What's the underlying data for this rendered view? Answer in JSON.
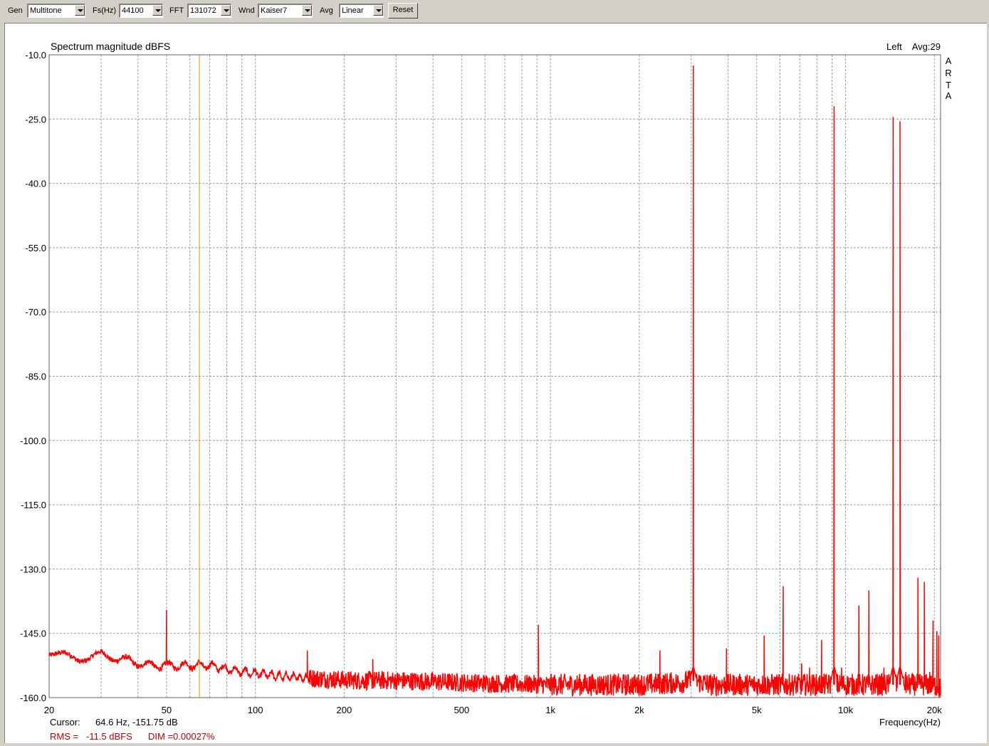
{
  "toolbar": {
    "gen_label": "Gen",
    "gen_value": "Multitone",
    "fs_label": "Fs(Hz)",
    "fs_value": "44100",
    "fft_label": "FFT",
    "fft_value": "131072",
    "wnd_label": "Wnd",
    "wnd_value": "Kaiser7",
    "avg_label": "Avg",
    "avg_value": "Linear",
    "reset_label": "Reset"
  },
  "plot": {
    "channel": "Left",
    "avg": "Avg:29",
    "brand_letters": [
      "A",
      "R",
      "T",
      "A"
    ],
    "cursor_label": "Cursor:",
    "cursor_value": "64.6 Hz, -151.75 dB",
    "rms_label": "RMS =",
    "rms_value": "-11.5 dBFS",
    "dim_label": "DIM =0.00027%"
  },
  "colors": {
    "trace": "#ff0000",
    "cursor_line": "#c8a000",
    "grid": "#a0a0a0",
    "rms_text": "#c00000"
  },
  "chart_data": {
    "type": "line",
    "title": "Spectrum magnitude dBFS",
    "xlabel": "Frequency(Hz)",
    "ylabel": "",
    "x_scale": "log",
    "xlim": [
      20,
      21000
    ],
    "ylim": [
      -160,
      -10
    ],
    "x_ticks": [
      20,
      50,
      100,
      200,
      500,
      1000,
      2000,
      5000,
      10000,
      20000
    ],
    "x_tick_labels": [
      "20",
      "50",
      "100",
      "200",
      "500",
      "1k",
      "2k",
      "5k",
      "10k",
      "20k"
    ],
    "y_ticks": [
      -10,
      -25,
      -40,
      -55,
      -70,
      -85,
      -100,
      -115,
      -130,
      -145,
      -160
    ],
    "y_tick_labels": [
      "-10.0",
      "-25.0",
      "-40.0",
      "-55.0",
      "-70.0",
      "-85.0",
      "-100.0",
      "-115.0",
      "-130.0",
      "-145.0",
      "-160.0"
    ],
    "grid": true,
    "cursor_x": 64.6,
    "noise_floor": [
      [
        20,
        -149.5
      ],
      [
        25,
        -151
      ],
      [
        30,
        -150
      ],
      [
        35,
        -151
      ],
      [
        40,
        -152
      ],
      [
        45,
        -152.5
      ],
      [
        55,
        -152.5
      ],
      [
        70,
        -152.5
      ],
      [
        90,
        -154
      ],
      [
        120,
        -155
      ],
      [
        160,
        -155.5
      ],
      [
        220,
        -156
      ],
      [
        300,
        -156
      ],
      [
        500,
        -156.5
      ],
      [
        1000,
        -157
      ],
      [
        2000,
        -157
      ],
      [
        2800,
        -156.5
      ],
      [
        3000,
        -156
      ],
      [
        3500,
        -157
      ],
      [
        5000,
        -157
      ],
      [
        10000,
        -157
      ],
      [
        20000,
        -157
      ],
      [
        21000,
        -158
      ]
    ],
    "series": [
      {
        "values": [
          [
            50,
            -139.5
          ],
          [
            150,
            -149
          ],
          [
            250,
            -151
          ],
          [
            910,
            -143
          ],
          [
            2350,
            -149
          ],
          [
            3050,
            -12.5
          ],
          [
            3950,
            -148.5
          ],
          [
            5300,
            -145.5
          ],
          [
            6150,
            -134
          ],
          [
            7100,
            -152
          ],
          [
            7550,
            -153
          ],
          [
            8300,
            -146.5
          ],
          [
            9150,
            -22
          ],
          [
            9700,
            -153
          ],
          [
            11100,
            -138.5
          ],
          [
            12000,
            -135
          ],
          [
            13500,
            -153
          ],
          [
            14500,
            -24.5
          ],
          [
            15300,
            -25.5
          ],
          [
            16000,
            -154
          ],
          [
            17600,
            -132
          ],
          [
            18500,
            -133
          ],
          [
            19300,
            -154
          ],
          [
            19800,
            -142
          ],
          [
            20400,
            -144.5
          ],
          [
            20700,
            -145.5
          ]
        ]
      }
    ]
  }
}
